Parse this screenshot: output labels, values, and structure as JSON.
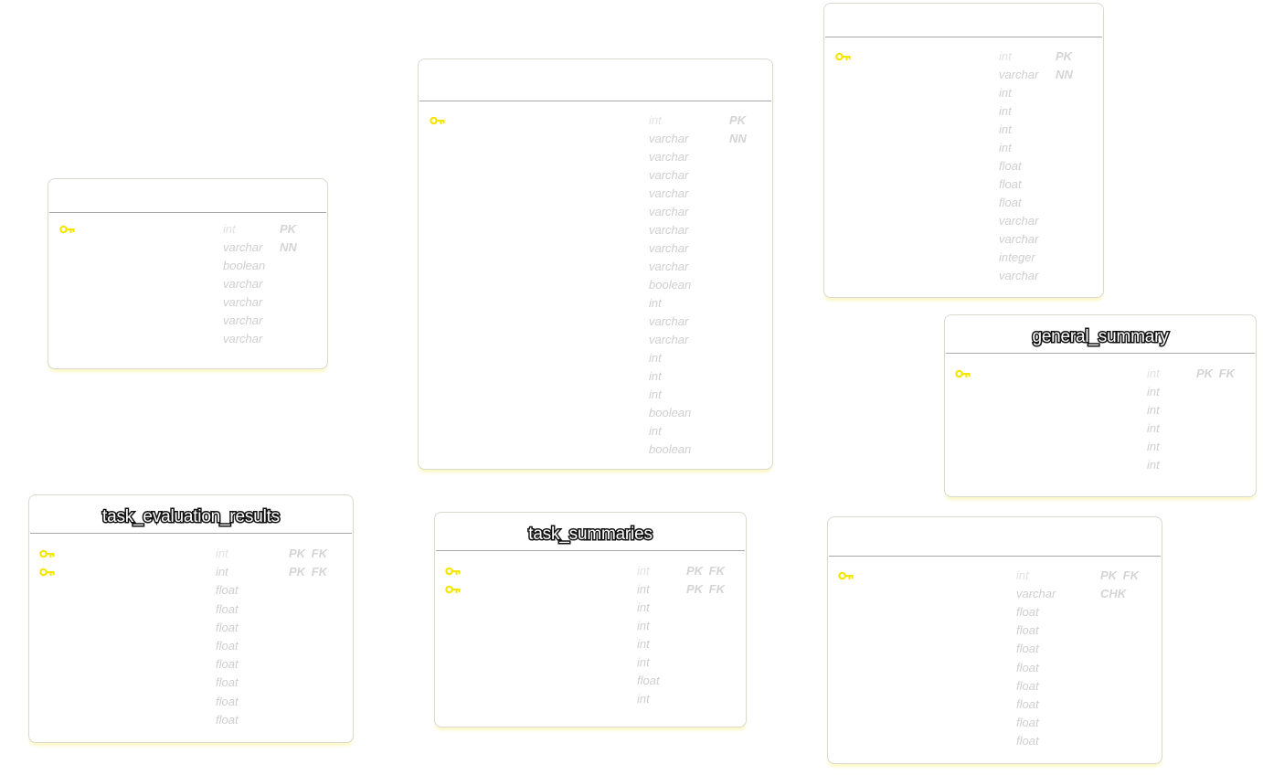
{
  "diagram": {
    "accent_color": "#f5e600",
    "key_icon": "key-icon",
    "tables": [
      {
        "id": "table-a",
        "title": "",
        "columns": [
          {
            "type": "int",
            "constraints": "PK",
            "key": true
          },
          {
            "type": "varchar",
            "constraints": "NN",
            "key": false
          },
          {
            "type": "boolean",
            "constraints": "",
            "key": false
          },
          {
            "type": "varchar",
            "constraints": "",
            "key": false
          },
          {
            "type": "varchar",
            "constraints": "",
            "key": false
          },
          {
            "type": "varchar",
            "constraints": "",
            "key": false
          },
          {
            "type": "varchar",
            "constraints": "",
            "key": false
          }
        ]
      },
      {
        "id": "table-b",
        "title": "",
        "columns": [
          {
            "type": "int",
            "constraints": "PK",
            "key": true
          },
          {
            "type": "varchar",
            "constraints": "NN",
            "key": false
          },
          {
            "type": "varchar",
            "constraints": "",
            "key": false
          },
          {
            "type": "varchar",
            "constraints": "",
            "key": false
          },
          {
            "type": "varchar",
            "constraints": "",
            "key": false
          },
          {
            "type": "varchar",
            "constraints": "",
            "key": false
          },
          {
            "type": "varchar",
            "constraints": "",
            "key": false
          },
          {
            "type": "varchar",
            "constraints": "",
            "key": false
          },
          {
            "type": "varchar",
            "constraints": "",
            "key": false
          },
          {
            "type": "boolean",
            "constraints": "",
            "key": false
          },
          {
            "type": "int",
            "constraints": "",
            "key": false
          },
          {
            "type": "varchar",
            "constraints": "",
            "key": false
          },
          {
            "type": "varchar",
            "constraints": "",
            "key": false
          },
          {
            "type": "int",
            "constraints": "",
            "key": false
          },
          {
            "type": "int",
            "constraints": "",
            "key": false
          },
          {
            "type": "int",
            "constraints": "",
            "key": false
          },
          {
            "type": "boolean",
            "constraints": "",
            "key": false
          },
          {
            "type": "int",
            "constraints": "",
            "key": false
          },
          {
            "type": "boolean",
            "constraints": "",
            "key": false
          }
        ]
      },
      {
        "id": "table-c",
        "title": "",
        "columns": [
          {
            "type": "int",
            "constraints": "PK",
            "key": true
          },
          {
            "type": "varchar",
            "constraints": "NN",
            "key": false
          },
          {
            "type": "int",
            "constraints": "",
            "key": false
          },
          {
            "type": "int",
            "constraints": "",
            "key": false
          },
          {
            "type": "int",
            "constraints": "",
            "key": false
          },
          {
            "type": "int",
            "constraints": "",
            "key": false
          },
          {
            "type": "float",
            "constraints": "",
            "key": false
          },
          {
            "type": "float",
            "constraints": "",
            "key": false
          },
          {
            "type": "float",
            "constraints": "",
            "key": false
          },
          {
            "type": "varchar",
            "constraints": "",
            "key": false
          },
          {
            "type": "varchar",
            "constraints": "",
            "key": false
          },
          {
            "type": "integer",
            "constraints": "",
            "key": false
          },
          {
            "type": "varchar",
            "constraints": "",
            "key": false
          }
        ]
      },
      {
        "id": "general-summary",
        "title": "general_summary",
        "columns": [
          {
            "type": "int",
            "constraints": "PK FK",
            "key": true
          },
          {
            "type": "int",
            "constraints": "",
            "key": false
          },
          {
            "type": "int",
            "constraints": "",
            "key": false
          },
          {
            "type": "int",
            "constraints": "",
            "key": false
          },
          {
            "type": "int",
            "constraints": "",
            "key": false
          },
          {
            "type": "int",
            "constraints": "",
            "key": false
          }
        ]
      },
      {
        "id": "task-evaluation-results",
        "title": "task_evaluation_results",
        "columns": [
          {
            "type": "int",
            "constraints": "PK FK",
            "key": true
          },
          {
            "type": "int",
            "constraints": "PK FK",
            "key": true
          },
          {
            "type": "float",
            "constraints": "",
            "key": false
          },
          {
            "type": "float",
            "constraints": "",
            "key": false
          },
          {
            "type": "float",
            "constraints": "",
            "key": false
          },
          {
            "type": "float",
            "constraints": "",
            "key": false
          },
          {
            "type": "float",
            "constraints": "",
            "key": false
          },
          {
            "type": "float",
            "constraints": "",
            "key": false
          },
          {
            "type": "float",
            "constraints": "",
            "key": false
          },
          {
            "type": "float",
            "constraints": "",
            "key": false
          }
        ]
      },
      {
        "id": "task-summaries",
        "title": "task_summaries",
        "columns": [
          {
            "type": "int",
            "constraints": "PK FK",
            "key": true
          },
          {
            "type": "int",
            "constraints": "PK FK",
            "key": true
          },
          {
            "type": "int",
            "constraints": "",
            "key": false
          },
          {
            "type": "int",
            "constraints": "",
            "key": false
          },
          {
            "type": "int",
            "constraints": "",
            "key": false
          },
          {
            "type": "int",
            "constraints": "",
            "key": false
          },
          {
            "type": "float",
            "constraints": "",
            "key": false
          },
          {
            "type": "int",
            "constraints": "",
            "key": false
          }
        ]
      },
      {
        "id": "table-g",
        "title": "",
        "columns": [
          {
            "type": "int",
            "constraints": "PK FK",
            "key": true
          },
          {
            "type": "varchar",
            "constraints": "CHK",
            "key": false
          },
          {
            "type": "float",
            "constraints": "",
            "key": false
          },
          {
            "type": "float",
            "constraints": "",
            "key": false
          },
          {
            "type": "float",
            "constraints": "",
            "key": false
          },
          {
            "type": "float",
            "constraints": "",
            "key": false
          },
          {
            "type": "float",
            "constraints": "",
            "key": false
          },
          {
            "type": "float",
            "constraints": "",
            "key": false
          },
          {
            "type": "float",
            "constraints": "",
            "key": false
          },
          {
            "type": "float",
            "constraints": "",
            "key": false
          }
        ]
      }
    ]
  }
}
